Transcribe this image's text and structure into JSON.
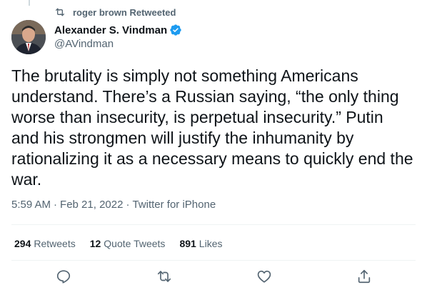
{
  "retweet_context": {
    "text": "roger brown Retweeted",
    "icon": "retweet-icon"
  },
  "author": {
    "name": "Alexander S. Vindman",
    "handle": "@AVindman",
    "verified_color": "#1d9bf0"
  },
  "tweet": {
    "text": "The brutality is simply not something Americans\nunderstand. There’s a Russian saying, “the only thing\nworse than insecurity, is perpetual insecurity.” Putin\nand his strongmen will justify the inhumanity by\nrationalizing it as a necessary means to quickly end the\nwar."
  },
  "meta": {
    "time": "5:59 AM",
    "separator1": "·",
    "date": "Feb 21, 2022",
    "separator2": "·",
    "source": "Twitter for iPhone"
  },
  "stats": {
    "retweets": {
      "count": "294",
      "label": "Retweets"
    },
    "quote_tweets": {
      "count": "12",
      "label": "Quote Tweets"
    },
    "likes": {
      "count": "891",
      "label": "Likes"
    }
  },
  "actions": [
    "reply-icon",
    "retweet-icon",
    "like-icon",
    "share-icon"
  ]
}
